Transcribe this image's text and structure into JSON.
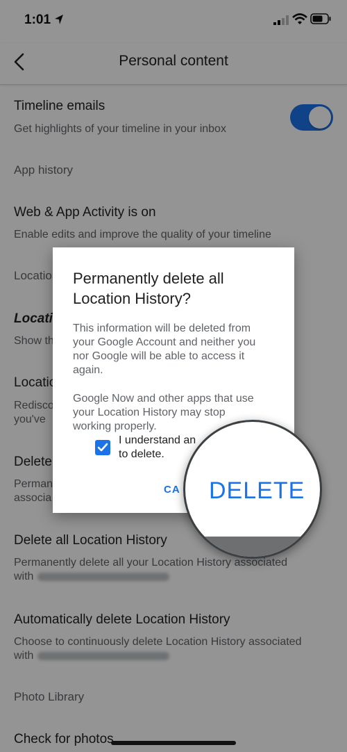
{
  "status_bar": {
    "time": "1:01"
  },
  "app_bar": {
    "title": "Personal content"
  },
  "rows": {
    "timeline_emails_title": "Timeline emails",
    "timeline_emails_sub": "Get highlights of your timeline in your inbox",
    "app_history": "App history",
    "web_activity_title": "Web & App Activity is on",
    "web_activity_sub": "Enable edits and improve the quality of your timeline",
    "location_section": "Locatio",
    "location_italic": "Locati",
    "location_italic_sub": "Show th",
    "location_title_2": "Locatio",
    "location_sub_2a": "Redisco",
    "location_sub_2b": "you've",
    "delete_title": "Delete",
    "delete_sub_a": "Perman",
    "delete_sub_b": "associa",
    "delete_all_title": "Delete all Location History",
    "delete_all_sub_a": "Permanently delete all your Location History associated",
    "delete_all_sub_b": "with",
    "auto_delete_title": "Automatically delete Location History",
    "auto_delete_sub_a": "Choose to continuously delete Location History associated",
    "auto_delete_sub_b": "with",
    "photo_library": "Photo Library",
    "check_photos": "Check for photos"
  },
  "toggle": {
    "state": "on",
    "color": "#1a73e8"
  },
  "dialog": {
    "title_line1": "Permanently delete all",
    "title_line2": "Location History?",
    "body1_line1": "This information will be deleted from",
    "body1_line2": "your Google Account and neither you",
    "body1_line3": "nor Google will be able to access it",
    "body1_line4": "again.",
    "body2_line1": "Google Now and other apps that use",
    "body2_line2": "your Location History may stop",
    "body2_line3": "working properly.",
    "checkbox_line1": "I understand an",
    "checkbox_line2": "to delete.",
    "checkbox_checked": true,
    "cancel_label": "CA",
    "delete_label": "DELETE"
  },
  "icons": {
    "back": "chevron-left-icon",
    "location": "location-arrow-icon",
    "signal": "cellular-signal-icon",
    "wifi": "wifi-icon",
    "battery": "battery-icon",
    "check": "checkmark-icon"
  },
  "colors": {
    "accent": "#1a73e8"
  }
}
